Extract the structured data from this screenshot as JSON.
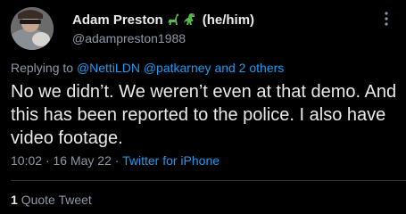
{
  "author": {
    "display_name": "Adam Preston",
    "emoji": [
      "sauropod-emoji",
      "t-rex-emoji"
    ],
    "pronouns": "(he/him)",
    "handle": "@adampreston1988"
  },
  "reply": {
    "prefix": "Replying to",
    "mention_1": "@NettiLDN",
    "mention_2": "@patkarney",
    "others": "and 2 others"
  },
  "tweet": {
    "text": "No we didn’t. We weren’t even at that demo. And this has been reported to the police. I also have video footage."
  },
  "meta": {
    "time": "10:02",
    "separator_1": "·",
    "date": "16 May 22",
    "separator_2": "·",
    "source": "Twitter for iPhone"
  },
  "stats": {
    "quote_count": "1",
    "quote_label": "Quote Tweet"
  },
  "colors": {
    "background": "#000000",
    "text": "#e7e9ea",
    "secondary": "#8b98a5",
    "link": "#1d9bf0",
    "divider": "#2f3336",
    "emoji_green": "#55b84a"
  }
}
